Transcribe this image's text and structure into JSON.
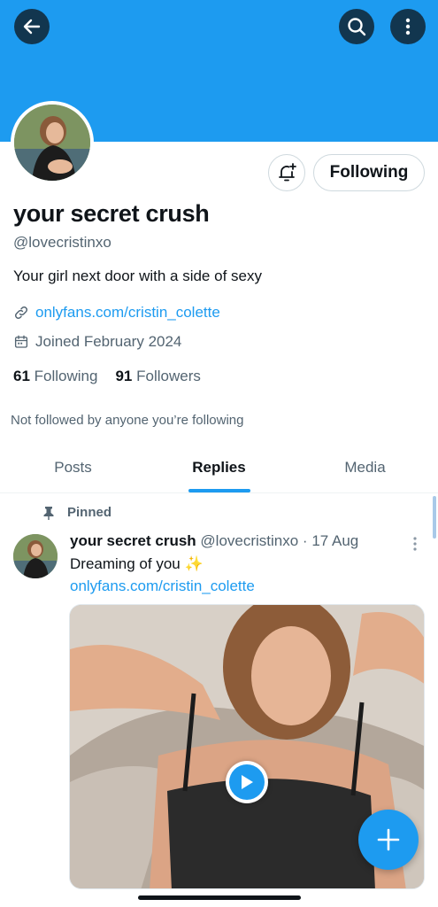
{
  "header": {
    "back_icon": "arrow-left-icon",
    "search_icon": "search-icon",
    "more_icon": "more-vertical-icon"
  },
  "profile": {
    "display_name": "your secret crush",
    "handle": "@lovecristinxo",
    "bio": "Your girl next door with a side of sexy",
    "link": "onlyfans.com/cristin_colette",
    "joined": "Joined February 2024",
    "following_count": "61",
    "following_label": "Following",
    "followers_count": "91",
    "followers_label": "Followers",
    "not_followed_text": "Not followed by anyone you’re following",
    "follow_button_label": "Following",
    "notification_icon": "bell-plus-icon"
  },
  "tabs": [
    {
      "label": "Posts"
    },
    {
      "label": "Replies"
    },
    {
      "label": "Media"
    }
  ],
  "post": {
    "pinned_label": "Pinned",
    "author_name": "your secret crush",
    "author_handle": "@lovecristinxo · 17 Aug",
    "text": "Dreaming of you ✨",
    "link": "onlyfans.com/cristin_colette"
  },
  "colors": {
    "accent": "#1d9bf0",
    "text_primary": "#0f1419",
    "text_secondary": "#536471"
  }
}
